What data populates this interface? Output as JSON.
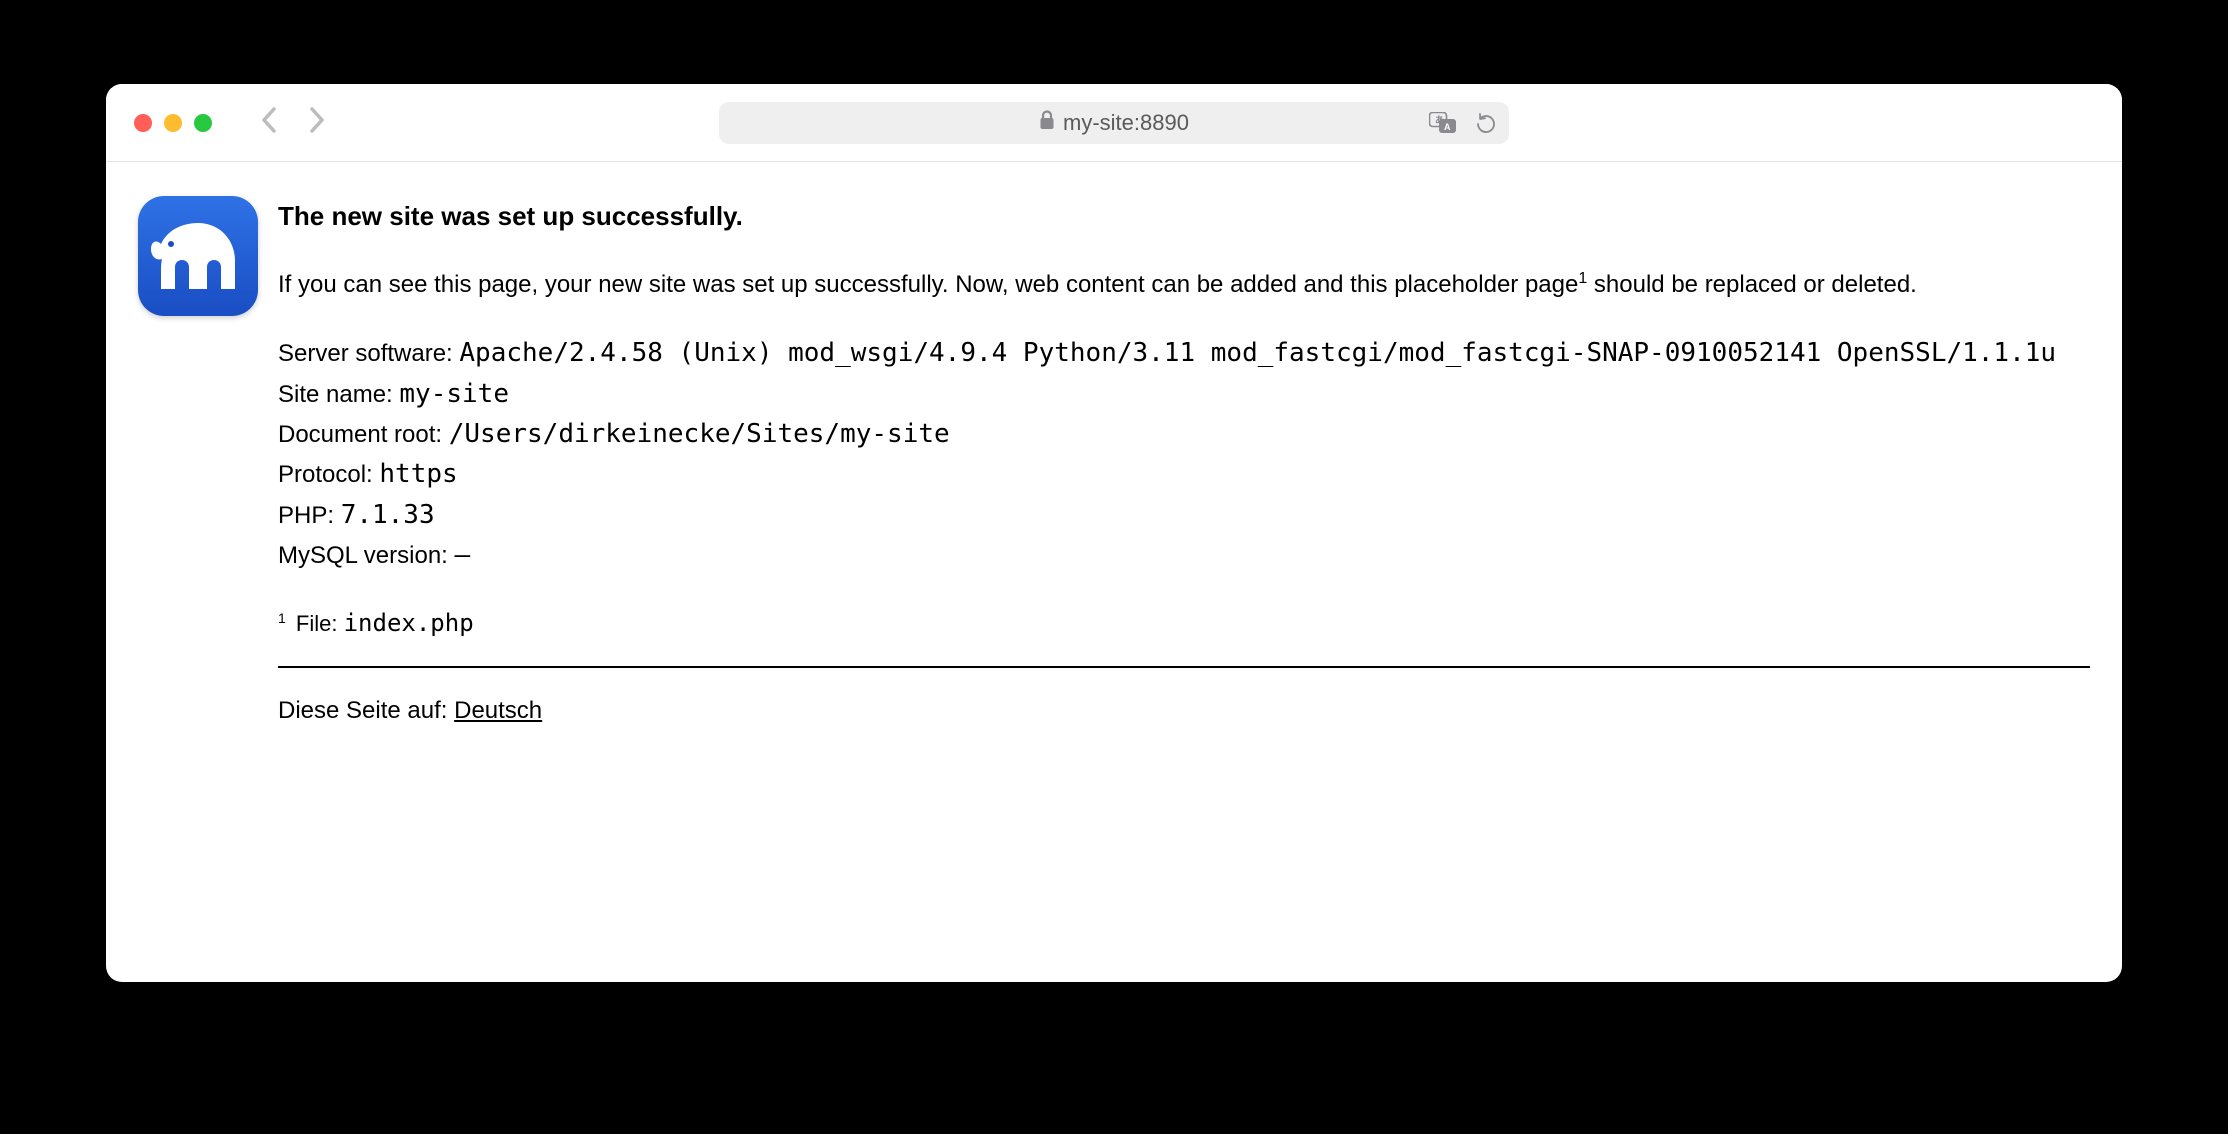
{
  "browser": {
    "address": "my-site:8890"
  },
  "page": {
    "title": "The new site was set up successfully.",
    "intro_prefix": "If you can see this page, your new site was set up successfully. Now, web content can be added and this placeholder page",
    "intro_sup": "1",
    "intro_suffix": " should be replaced or deleted.",
    "details": {
      "server_software_label": "Server software: ",
      "server_software_value": "Apache/2.4.58 (Unix) mod_wsgi/4.9.4 Python/3.11 mod_fastcgi/mod_fastcgi-SNAP-0910052141 OpenSSL/1.1.1u",
      "site_name_label": "Site name: ",
      "site_name_value": "my-site",
      "document_root_label": "Document root: ",
      "document_root_value": "/Users/dirkeinecke/Sites/my-site",
      "protocol_label": "Protocol: ",
      "protocol_value": "https",
      "php_label": "PHP: ",
      "php_value": "7.1.33",
      "mysql_label": "MySQL version: ",
      "mysql_value": "–"
    },
    "footnote": {
      "sup": "1",
      "label": " File: ",
      "value": "index.php"
    },
    "lang": {
      "prefix": "Diese Seite auf: ",
      "link": "Deutsch"
    }
  }
}
